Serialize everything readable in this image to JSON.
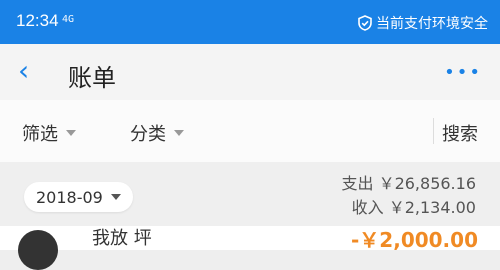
{
  "status_bar": {
    "time": "12:34",
    "signal": "4G",
    "security_text": "当前支付环境安全"
  },
  "header": {
    "title": "账单",
    "more_icon": "more-icon"
  },
  "filters": {
    "filter_label": "筛选",
    "category_label": "分类",
    "search_label": "搜索"
  },
  "month_bar": {
    "month": "2018-09",
    "expense_label": "支出",
    "expense_value": "￥26,856.16",
    "income_label": "收入",
    "income_value": "￥2,134.00"
  },
  "list_item": {
    "name_partial": "我放 坪",
    "amount_partial": "-￥2,000.00"
  },
  "colors": {
    "primary": "#1a82e6",
    "accent": "#f08a24"
  }
}
